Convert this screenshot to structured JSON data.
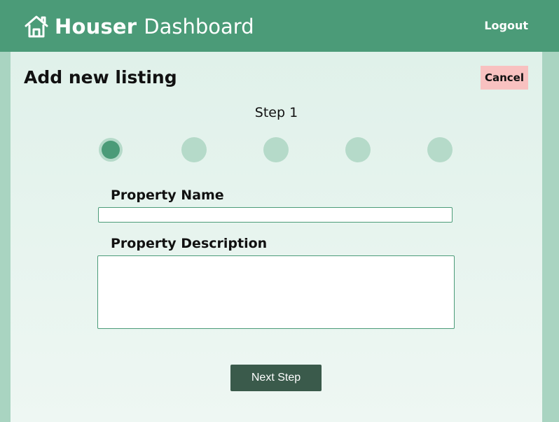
{
  "header": {
    "brand_strong": "Houser",
    "brand_light": "Dashboard",
    "home_icon": "home-icon",
    "logout_label": "Logout"
  },
  "page": {
    "title": "Add new listing",
    "cancel_label": "Cancel",
    "step_label": "Step 1",
    "steps_total": 5,
    "active_step": 1
  },
  "form": {
    "property_name_label": "Property Name",
    "property_name_value": "",
    "property_description_label": "Property Description",
    "property_description_value": "",
    "next_label": "Next Step"
  },
  "colors": {
    "header_bg": "#4b9b78",
    "page_bg": "#a9d4c1",
    "panel_bg": "#e0f1ea",
    "cancel_bg": "#f8c1c0",
    "next_bg": "#3a5a4b",
    "step_inactive": "#b5dac9",
    "step_active": "#4b9b78"
  }
}
